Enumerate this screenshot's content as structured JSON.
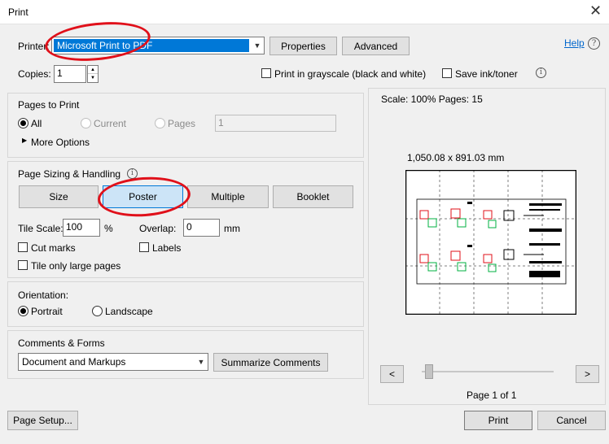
{
  "window": {
    "title": "Print",
    "close_glyph": "✕"
  },
  "printer": {
    "label": "Printer:",
    "value": "Microsoft Print to PDF",
    "properties_label": "Properties",
    "advanced_label": "Advanced",
    "help_label": "Help"
  },
  "copies": {
    "label": "Copies:",
    "value": "1"
  },
  "options": {
    "grayscale_label": "Print in grayscale (black and white)",
    "save_ink_label": "Save ink/toner"
  },
  "pages_to_print": {
    "title": "Pages to Print",
    "all_label": "All",
    "current_label": "Current",
    "pages_label": "Pages",
    "pages_value": "1",
    "more_options_label": "More Options"
  },
  "sizing": {
    "title": "Page Sizing & Handling",
    "buttons": [
      "Size",
      "Poster",
      "Multiple",
      "Booklet"
    ],
    "tile_scale_label": "Tile Scale:",
    "tile_scale_value": "100",
    "tile_scale_unit": "%",
    "overlap_label": "Overlap:",
    "overlap_value": "0",
    "overlap_unit": "mm",
    "cut_marks_label": "Cut marks",
    "labels_label": "Labels",
    "tile_large_label": "Tile only large pages"
  },
  "orientation": {
    "title": "Orientation:",
    "portrait_label": "Portrait",
    "landscape_label": "Landscape"
  },
  "comments": {
    "title": "Comments & Forms",
    "value": "Document and Markups",
    "summarize_label": "Summarize Comments"
  },
  "preview": {
    "scale_text": "Scale: 100% Pages: 15",
    "dimensions_text": "1,050.08 x 891.03 mm",
    "prev_glyph": "<",
    "next_glyph": ">",
    "page_text": "Page 1 of 1"
  },
  "footer": {
    "page_setup_label": "Page Setup...",
    "print_label": "Print",
    "cancel_label": "Cancel"
  },
  "colors": {
    "accent": "#0078d7",
    "annotation": "#e0101a",
    "link": "#0066cc"
  }
}
